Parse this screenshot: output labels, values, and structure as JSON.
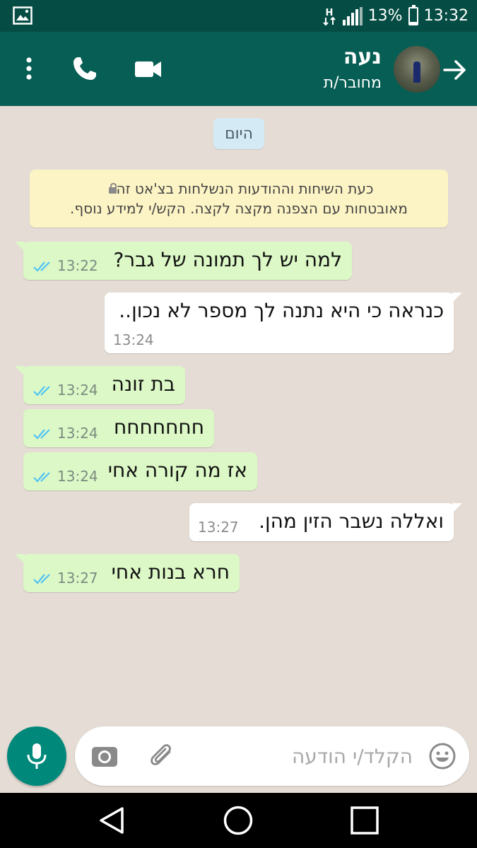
{
  "status_bar": {
    "battery": "13%",
    "battery_level": 0.13,
    "time": "13:32",
    "network": "H"
  },
  "header": {
    "contact_name": "נעה",
    "contact_status": "מחובר/ת",
    "icons": [
      "back-arrow-icon",
      "avatar",
      "video-call-icon",
      "phone-icon",
      "more-vert-icon"
    ],
    "color": "#075e54"
  },
  "chat": {
    "date_label": "היום",
    "encryption_notice": {
      "line1": "כעת השיחות וההודעות הנשלחות בצ'אט זה",
      "line2": "מאובטחות עם הצפנה מקצה לקצה. הקש/י למידע נוסף."
    },
    "messages": [
      {
        "direction": "out",
        "text": "למה יש לך תמונה של גבר?",
        "time": "13:22",
        "read": true
      },
      {
        "direction": "in",
        "text": "כנראה כי היא נתנה לך מספר לא נכון..",
        "time": "13:24"
      },
      {
        "direction": "out",
        "text": "בת זונה",
        "time": "13:24",
        "read": true
      },
      {
        "direction": "out",
        "text": "חחחחחחח",
        "time": "13:24",
        "read": true
      },
      {
        "direction": "out",
        "text": "אז מה קורה אחי",
        "time": "13:24",
        "read": true
      },
      {
        "direction": "in",
        "text": "ואללה נשבר הזין מהן.",
        "time": "13:27"
      },
      {
        "direction": "out",
        "text": "חרא בנות אחי",
        "time": "13:27",
        "read": true
      }
    ],
    "colors": {
      "background": "#e5ddd5",
      "outgoing": "#dcf8c6",
      "incoming": "#ffffff",
      "read_ticks": "#4fc3f7"
    }
  },
  "input": {
    "placeholder": "הקלד/י הודעה",
    "value": "",
    "icons": [
      "emoji-icon",
      "attach-icon",
      "camera-icon",
      "mic-icon"
    ],
    "mic_color": "#00897b"
  },
  "nav_bar": {
    "icons": [
      "back-triangle-icon",
      "home-circle-icon",
      "recents-square-icon"
    ]
  }
}
